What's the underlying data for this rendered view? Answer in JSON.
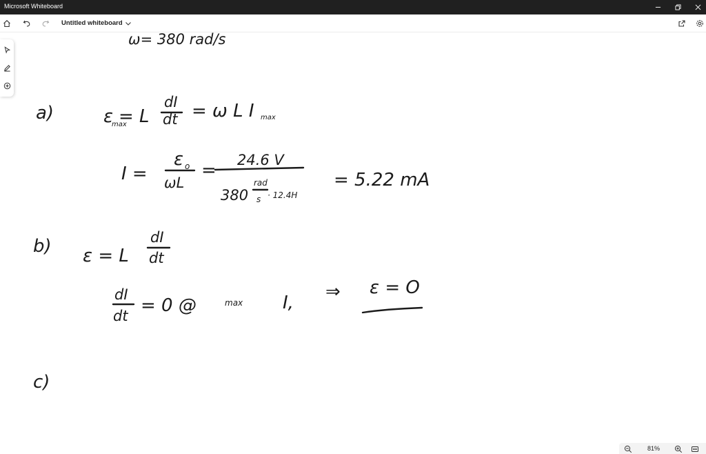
{
  "window": {
    "app_title": "Microsoft Whiteboard"
  },
  "toolbar": {
    "doc_title": "Untitled whiteboard"
  },
  "board": {
    "omega_line": "ω= 380 rad/s",
    "part_a": {
      "label": "a)",
      "eq1_lhs": "ε",
      "eq1_sub": "max",
      "eq1_mid": "= L",
      "dI": "dI",
      "dt": "dt",
      "eq1_rhs": "= ω L I",
      "eq1_rhs_sub": "max",
      "eq2_lhs": "I =",
      "eq2_num": "ε",
      "eq2_num_sub": "o",
      "eq2_den": "ωL",
      "eq2_eq": "=",
      "eq2_num2": "24.6 V",
      "eq2_den2_a": "380",
      "eq2_den2_rad": "rad",
      "eq2_den2_s": "s",
      "eq2_den2_b": "· 12.4H",
      "eq2_result": "= 5.22 mA"
    },
    "part_b": {
      "label": "b)",
      "eq1": "ε = L",
      "dI": "dI",
      "dt": "dt",
      "eq2_dI": "dI",
      "eq2_dt": "dt",
      "eq2_rest": "= 0  @",
      "eq2_max": "max",
      "eq2_I": "I,",
      "arrow": "⇒",
      "result": "ε = O"
    },
    "part_c": {
      "label": "c)"
    }
  },
  "status": {
    "zoom": "81%"
  }
}
